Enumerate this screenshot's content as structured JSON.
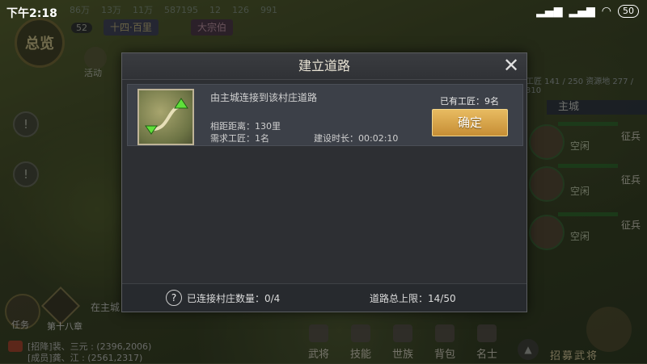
{
  "status_bar": {
    "time": "下午2:18",
    "battery": "50"
  },
  "top_bar": {
    "values": [
      "86万",
      "13万",
      "11万",
      "587195",
      "12",
      "126",
      "991"
    ]
  },
  "left": {
    "overview_label": "总览",
    "level": "52",
    "chip1": "十四·百里",
    "chip2": "大宗伯",
    "activity_label": "活动",
    "task_label": "任务",
    "chapter_label": "第十八章",
    "in_city_label": "在主城"
  },
  "chat": [
    "[招降]裴、三元 : (2396,2006)",
    "[成员]龚、江 : (2561,2317)"
  ],
  "bottom_menu": [
    "武将",
    "技能",
    "世族",
    "背包",
    "名士"
  ],
  "recruit_label": "招募武将",
  "right": {
    "info": "工匠 141 / 250  资源地 277 / 310",
    "main_city": "主城",
    "heroes": [
      {
        "status": "空闲",
        "action": "征兵"
      },
      {
        "status": "空闲",
        "action": "征兵"
      },
      {
        "status": "空闲",
        "action": "征兵"
      }
    ]
  },
  "dialog": {
    "title": "建立道路",
    "route": {
      "title": "由主城连接到该村庄道路",
      "distance": "相距距离：130里",
      "workers_needed": "需求工匠：1名",
      "build_time": "建设时长：00:02:10",
      "workers_have": "已有工匠：9名",
      "confirm": "确定"
    },
    "footer": {
      "help": "?",
      "connected_villages": "已连接村庄数量：0/4",
      "road_limit": "道路总上限：14/50"
    }
  },
  "colors": {
    "confirm_button": "#d9a549",
    "dialog_bg": "#2d2f33",
    "route_row_bg": "#3c4048"
  }
}
